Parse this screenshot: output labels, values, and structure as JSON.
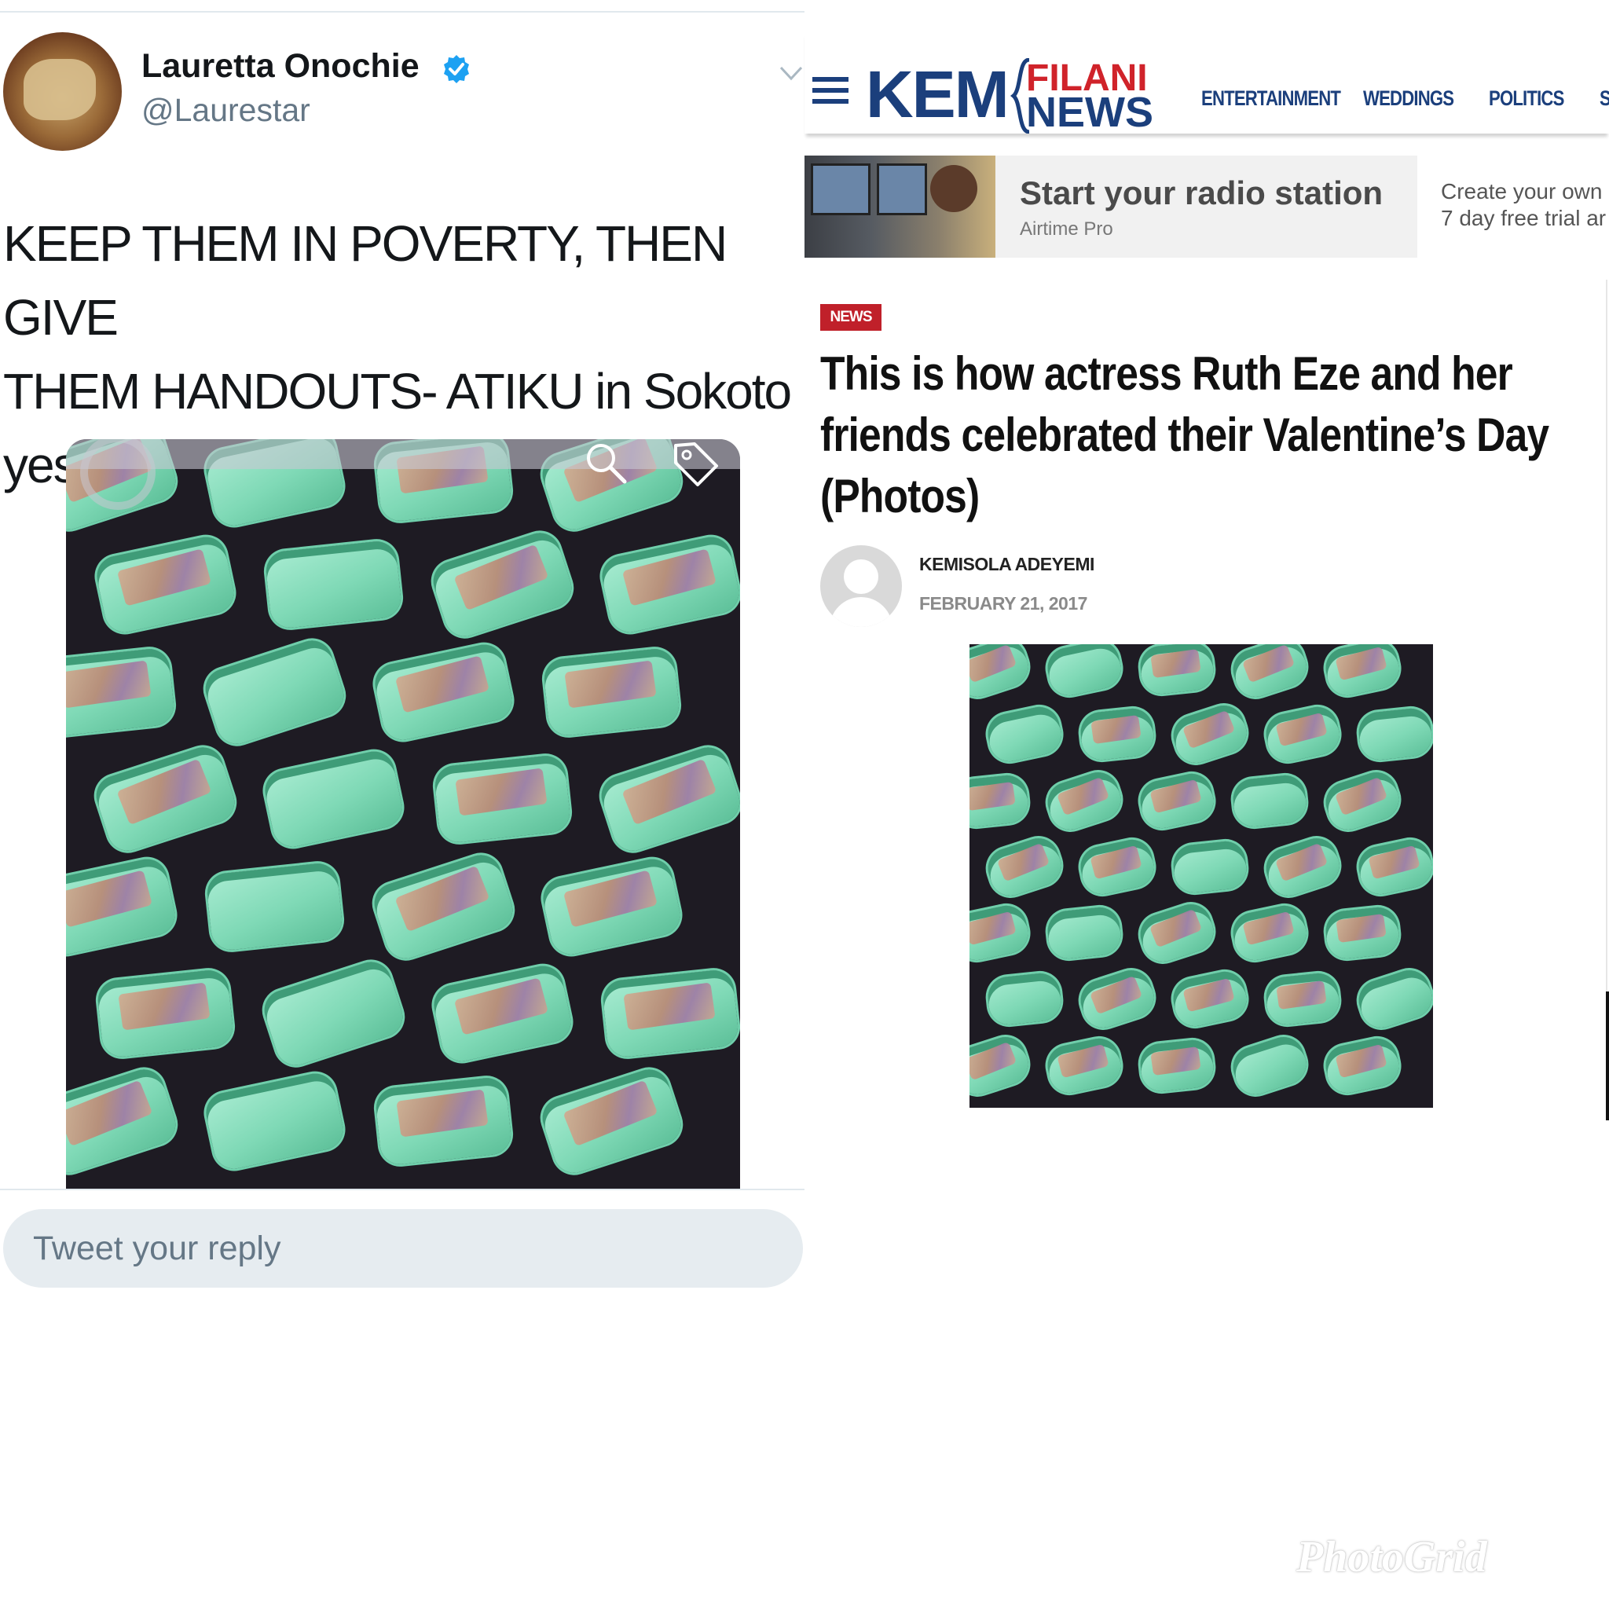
{
  "tweet": {
    "author_name": "Lauretta Onochie",
    "handle": "@Laurestar",
    "text_lines": [
      "KEEP THEM IN POVERTY, THEN GIVE",
      "THEM HANDOUTS- ATIKU in Sokoto",
      "yesterday"
    ],
    "reply_placeholder": "Tweet your reply",
    "icons": [
      "verified-badge-icon",
      "chevron-down-icon",
      "search-icon",
      "tag-icon"
    ],
    "colors": {
      "verified": "#1da1f2",
      "text": "#14171a",
      "secondary": "#657786",
      "reply_bg": "#e6ecf0"
    }
  },
  "article": {
    "site": {
      "logo_kem": "KEM",
      "logo_filani": "FILANI",
      "logo_news": "NEWS"
    },
    "nav": [
      "ENTERTAINMENT",
      "WEDDINGS",
      "POLITICS",
      "S"
    ],
    "ad": {
      "title": "Start your radio station",
      "sponsor": "Airtime Pro",
      "side_lines": [
        "Create your own",
        "7 day free trial ar"
      ]
    },
    "category": "NEWS",
    "headline_lines": [
      "This is how actress Ruth Eze and her",
      "friends celebrated their Valentine’s Day",
      "(Photos)"
    ],
    "author": "KEMISOLA ADEYEMI",
    "date": "FEBRUARY 21, 2017",
    "colors": {
      "brand_blue": "#1b3f7c",
      "brand_red": "#d0232a",
      "badge": "#c0202a"
    }
  },
  "watermark": "PhotoGrid"
}
